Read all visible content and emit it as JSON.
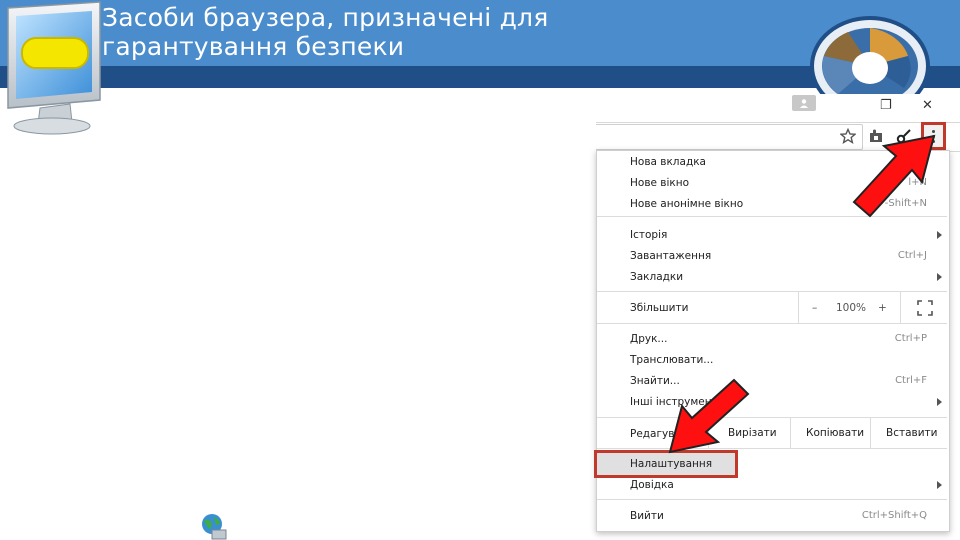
{
  "slide": {
    "title": "Засоби браузера, призначені для\nгарантування безпеки"
  },
  "colors": {
    "header_light": "#4a8ccc",
    "header_dark": "#1f4f86",
    "highlight_red": "#c0392b",
    "arrow_red": "#ff1010"
  },
  "icons": [
    "monitor-icon",
    "logo-circle-icon",
    "globe-network-icon",
    "profile-icon",
    "restore-icon",
    "close-icon",
    "star-icon",
    "extension-icon",
    "key-icon",
    "menu-dots-icon",
    "fullscreen-icon"
  ],
  "menu": {
    "group1": [
      {
        "label": "Нова вкладка",
        "shortcut": ""
      },
      {
        "label": "Нове вікно",
        "shortcut": "l+N"
      },
      {
        "label": "Нове анонімне вікно",
        "shortcut": "-Shift+N"
      }
    ],
    "group2": [
      {
        "label": "Історія",
        "shortcut": ""
      },
      {
        "label": "Завантаження",
        "shortcut": "Ctrl+J"
      },
      {
        "label": "Закладки",
        "shortcut": ""
      }
    ],
    "zoom": {
      "label": "Збільшити",
      "minus": "–",
      "value": "100%",
      "plus": "+"
    },
    "group3": [
      {
        "label": "Друк...",
        "shortcut": "Ctrl+P"
      },
      {
        "label": "Транслювати...",
        "shortcut": ""
      },
      {
        "label": "Знайти...",
        "shortcut": "Ctrl+F"
      },
      {
        "label": "Інші інструмент",
        "shortcut": ""
      }
    ],
    "edit": {
      "label": "Редагува",
      "cut": "Вирізати",
      "copy": "Копіювати",
      "paste": "Вставити"
    },
    "group4": [
      {
        "label": "Налаштування",
        "shortcut": ""
      },
      {
        "label": "Довідка",
        "shortcut": ""
      }
    ],
    "exit": {
      "label": "Вийти",
      "shortcut": "Ctrl+Shift+Q"
    }
  }
}
